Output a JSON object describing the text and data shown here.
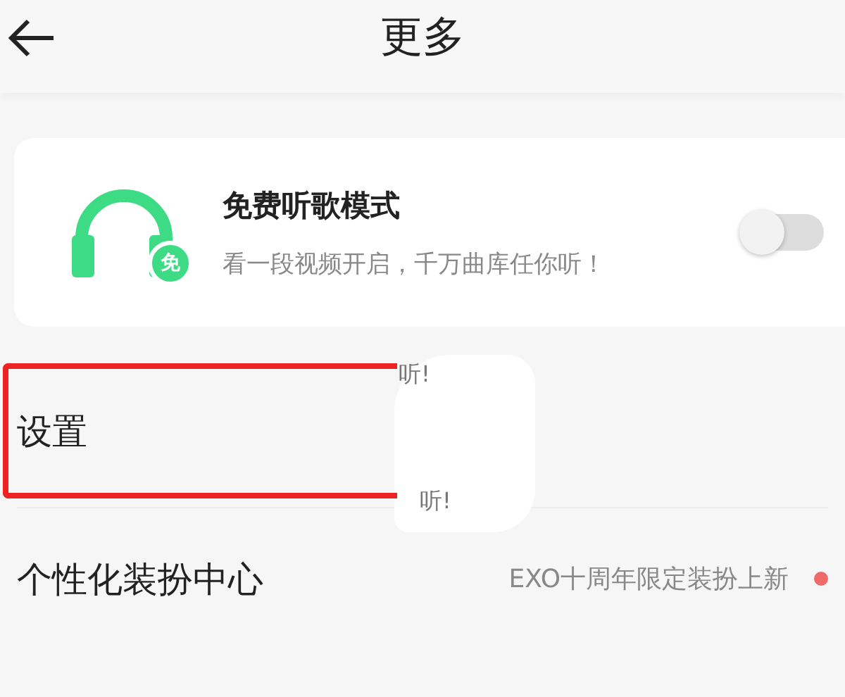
{
  "header": {
    "title": "更多"
  },
  "free_mode_card": {
    "title": "免费听歌模式",
    "subtitle": "看一段视频开启，千万曲库任你听！",
    "badge": "免",
    "on": false
  },
  "rows": [
    {
      "label": "设置",
      "highlighted": true,
      "stray_texts": [
        "听!",
        "听!"
      ]
    },
    {
      "label": "个性化装扮中心",
      "detail": "EXO十周年限定装扮上新",
      "dot": true
    }
  ]
}
